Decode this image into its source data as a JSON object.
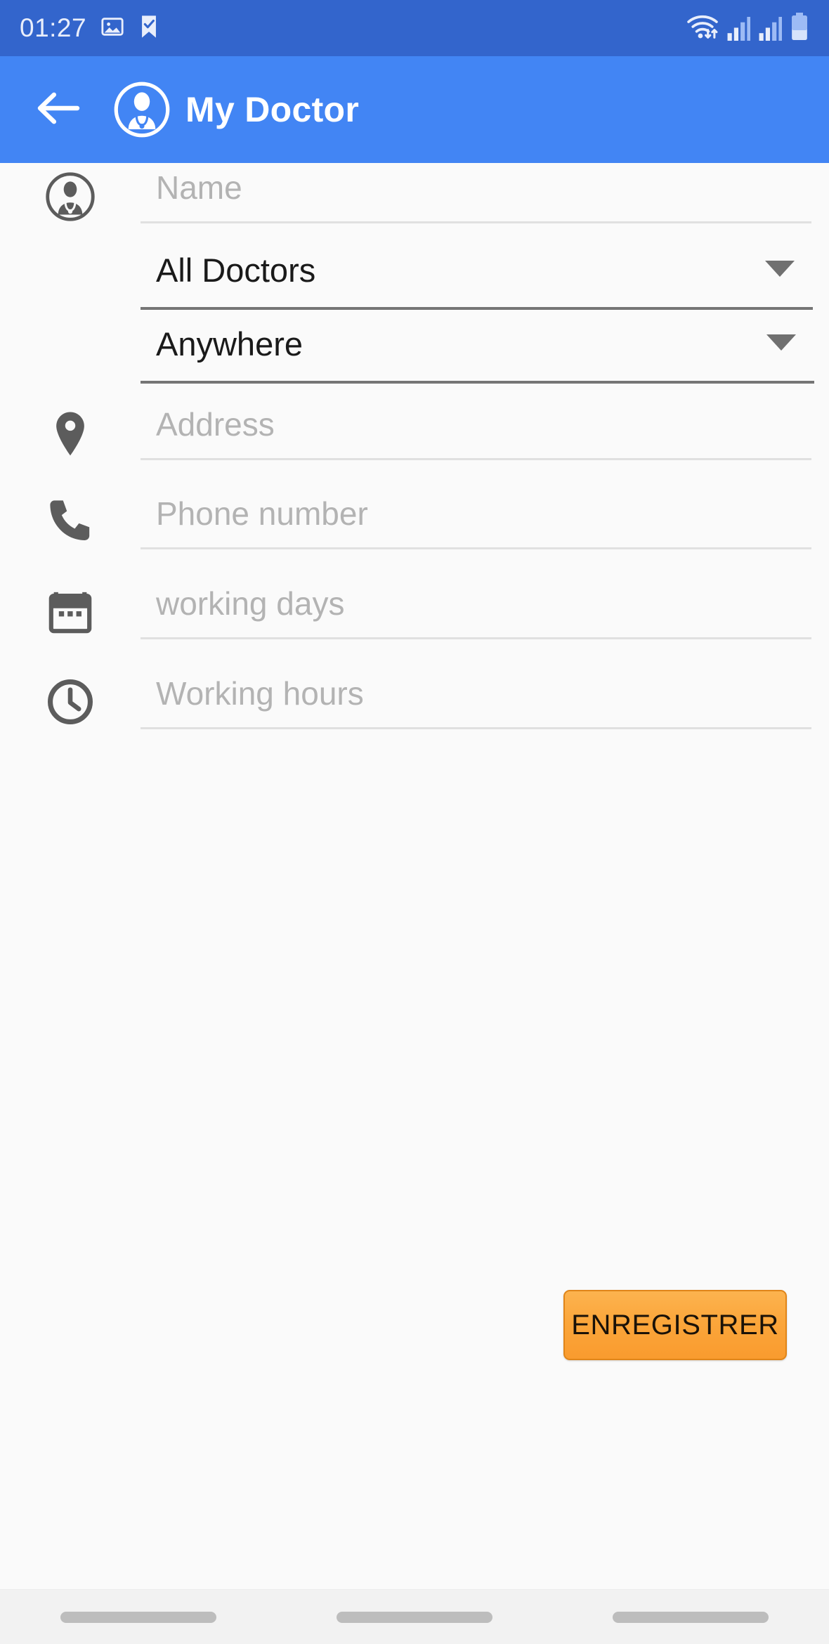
{
  "status_bar": {
    "time": "01:27",
    "icons": [
      "image-icon",
      "flag-check-icon",
      "wifi-icon",
      "signal-1-icon",
      "signal-2-icon",
      "battery-icon"
    ],
    "background_color": "#3365cc",
    "battery_level_percent": 40
  },
  "app_bar": {
    "back_label": "back-arrow",
    "logo_label": "doctor-logo",
    "title": "My Doctor",
    "background_color": "#4285f4",
    "title_color": "#ffffff"
  },
  "form": {
    "name": {
      "icon": "doctor-avatar-icon",
      "placeholder": "Name",
      "value": ""
    },
    "specialty_select": {
      "value": "All Doctors",
      "caret": "chevron-down-icon"
    },
    "location_select": {
      "value": "Anywhere",
      "caret": "chevron-down-icon"
    },
    "address": {
      "icon": "location-pin-icon",
      "placeholder": "Address",
      "value": ""
    },
    "phone": {
      "icon": "phone-icon",
      "placeholder": "Phone number",
      "value": ""
    },
    "working_days": {
      "icon": "calendar-icon",
      "placeholder": "working days",
      "value": ""
    },
    "working_hours": {
      "icon": "clock-icon",
      "placeholder": "Working hours",
      "value": ""
    }
  },
  "actions": {
    "save_label": "ENREGISTRER",
    "save_color": "#fba63b",
    "save_border_color": "#e08519"
  },
  "nav_bar": {
    "pills": [
      "recents-pill",
      "home-pill",
      "back-pill"
    ]
  },
  "theme": {
    "background": "#fafafa",
    "placeholder_color": "#b3b3b3",
    "value_color": "#1a1a1a",
    "icon_color": "#616161",
    "underline_light": "#e0e0e0",
    "underline_dark": "#757575"
  }
}
